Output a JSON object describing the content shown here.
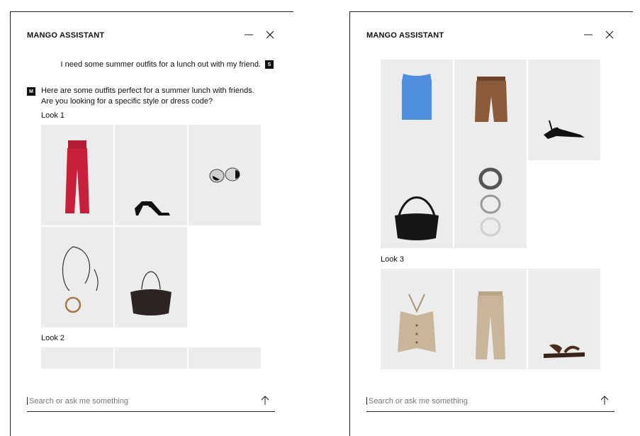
{
  "panels": [
    {
      "title": "MANGO ASSISTANT",
      "user_message": "I need some summer outfits for a lunch out with my friend.",
      "user_avatar": "S",
      "bot_avatar": "M",
      "bot_message": "Here are some outfits perfect for a summer lunch with friends. Are you looking for a specific style or dress code?",
      "looks": [
        "Look 1",
        "Look 2"
      ],
      "products_look1": [
        "red-jumpsuit-image",
        "black-strappy-heels-image",
        "silver-earrings-image",
        "silver-pendant-necklace-image",
        "black-shoulder-bag-image"
      ],
      "search_placeholder": "Search or ask me something"
    },
    {
      "title": "MANGO ASSISTANT",
      "products_look2": [
        "blue-sleeveless-top-image",
        "brown-shorts-image",
        "black-strappy-sandals-image",
        "black-woven-bag-image",
        "bangles-image"
      ],
      "looks": [
        "Look 3"
      ],
      "products_look3": [
        "beige-halter-vest-image",
        "beige-trousers-image",
        "brown-flat-sandals-image"
      ],
      "search_placeholder": "Search or ask me something"
    }
  ],
  "icons": {
    "minimize": "minimize-icon",
    "close": "close-icon",
    "send": "arrow-up-icon"
  },
  "colors": {
    "accent": "#111111",
    "tile_background": "#ececec",
    "jumpsuit_red": "#c8203a",
    "top_blue": "#4f8fe0",
    "shorts_brown": "#8a5a3a",
    "beige": "#c9b59a"
  }
}
